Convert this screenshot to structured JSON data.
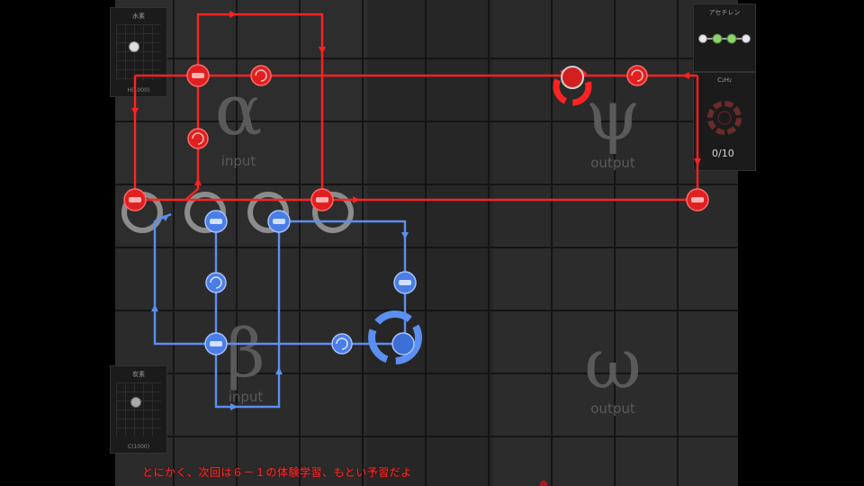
{
  "zones": {
    "alpha": {
      "letter": "α",
      "label": "input"
    },
    "beta": {
      "letter": "β",
      "label": "input"
    },
    "psi": {
      "letter": "ψ",
      "label": "output"
    },
    "omega": {
      "letter": "ω",
      "label": "output"
    }
  },
  "left_panels": {
    "top": {
      "title": "水素",
      "footer": "H(1000)"
    },
    "bottom": {
      "title": "炭素",
      "footer": "C(1000)"
    }
  },
  "right_panels": {
    "molecule_title": "アセチレン",
    "counter_title": "C₂H₂",
    "counter": "0/10"
  },
  "subtitle": "とにかく、次回は６－１の体験学習、もとい予習だよ",
  "colors": {
    "red_waldo": "#ff2222",
    "blue_waldo": "#5b8ff0",
    "board": "#262626",
    "grid_line": "#141414",
    "zone_text": "#5a5a5a"
  }
}
